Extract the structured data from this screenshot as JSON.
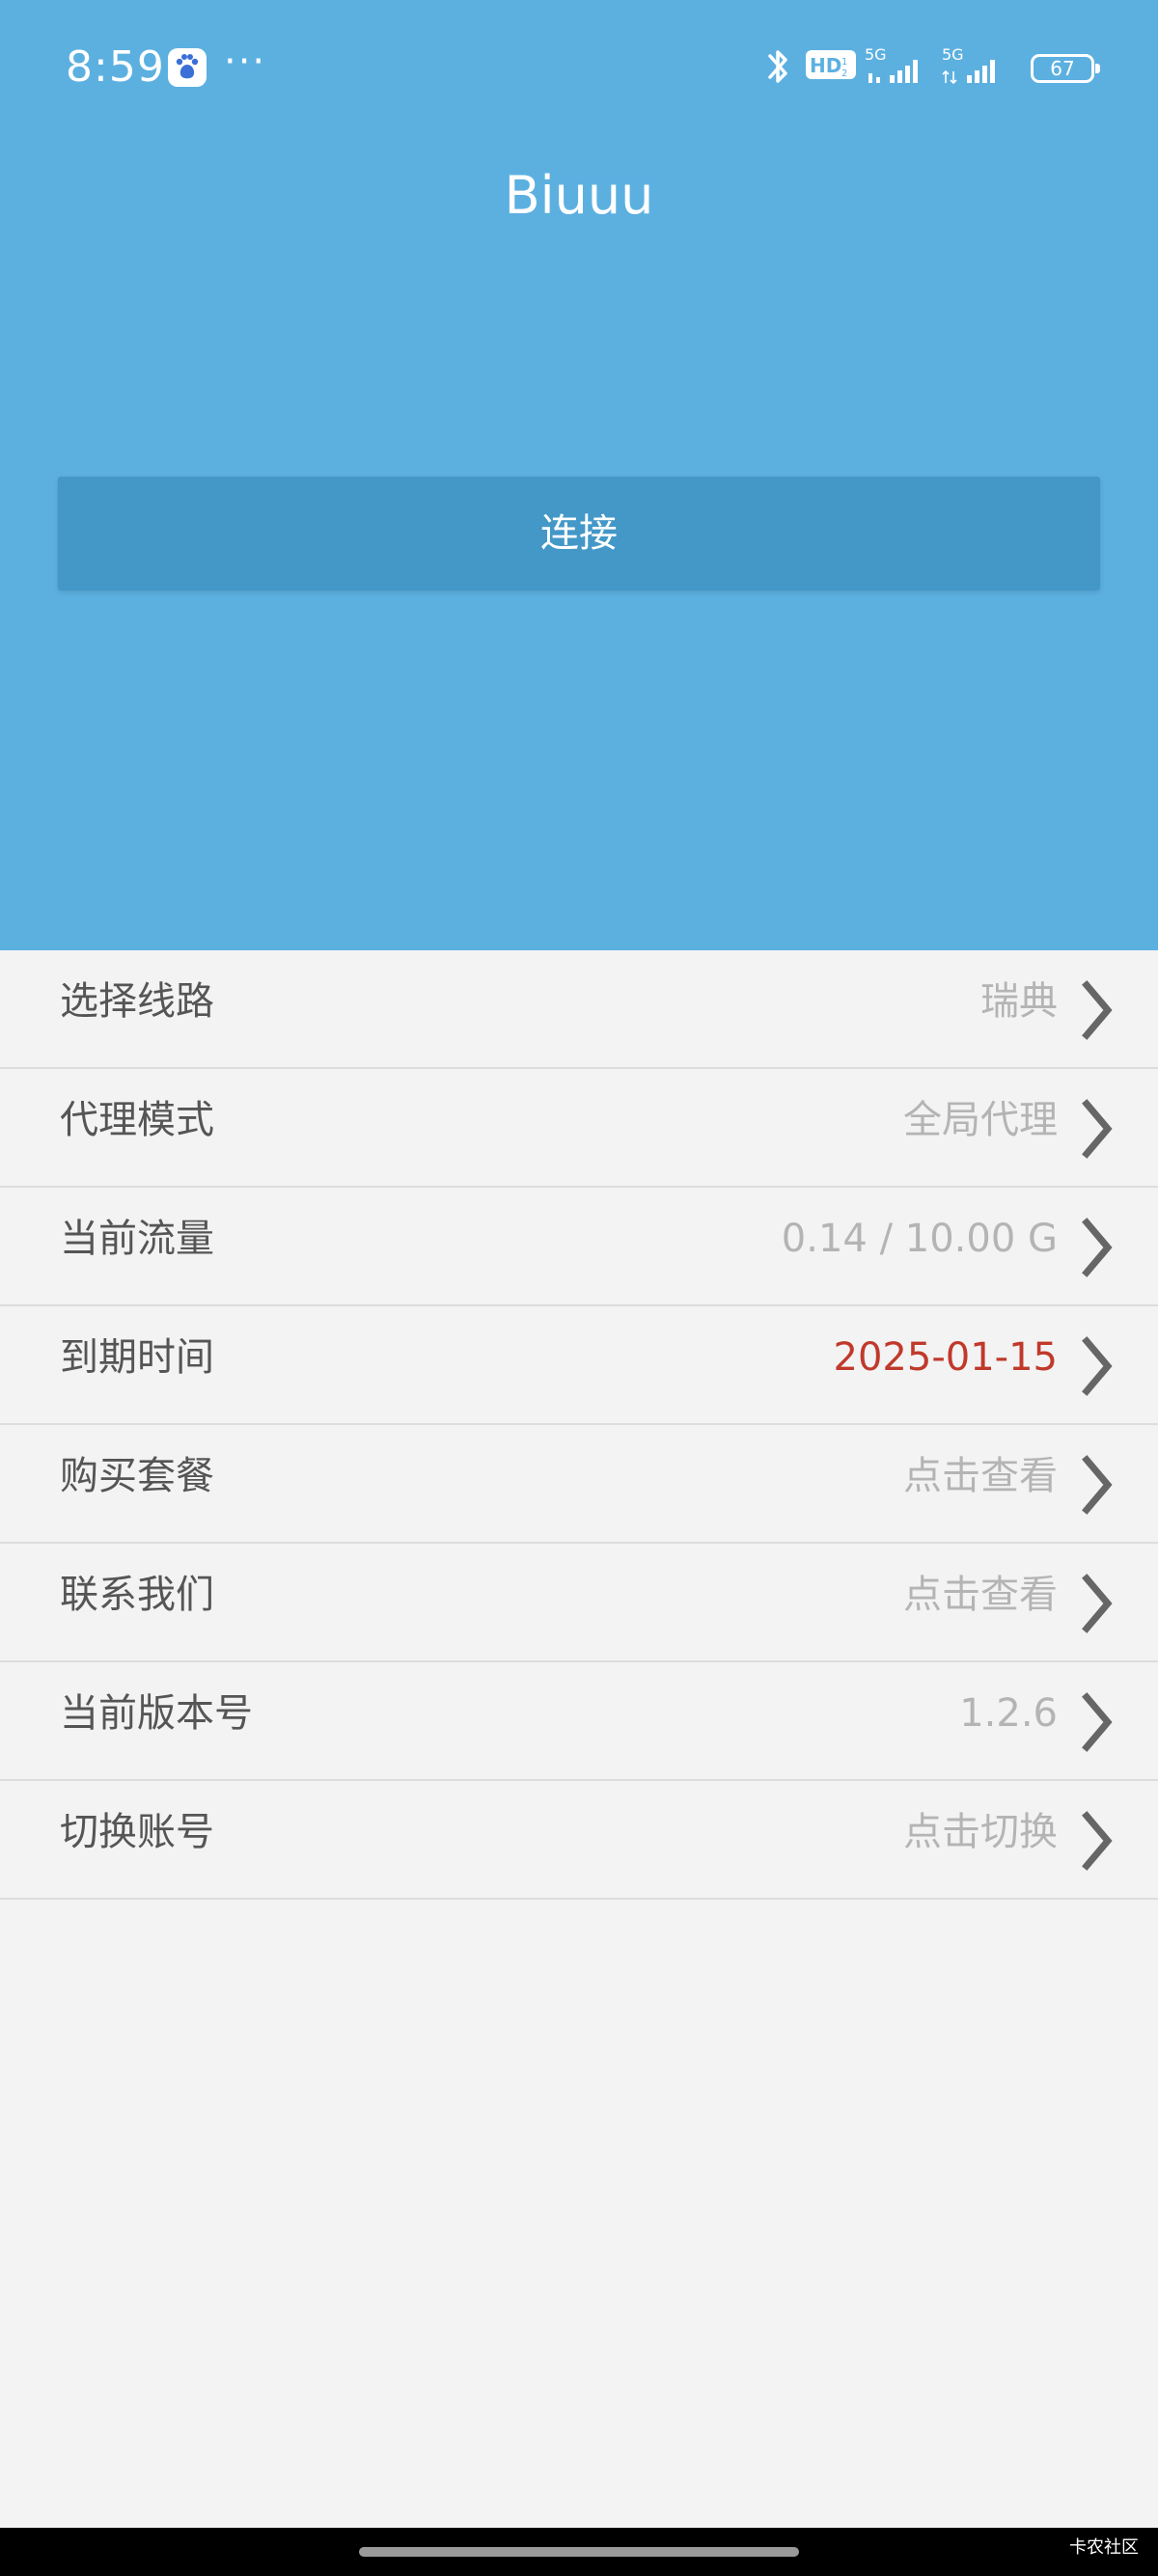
{
  "status_bar": {
    "time": "8:59",
    "more": "···",
    "battery": "67",
    "icons": [
      "baidu-app-icon",
      "bluetooth-icon",
      "hd-voice-icon",
      "signal-5g-icon",
      "signal-5g-icon",
      "battery-icon"
    ]
  },
  "header": {
    "title": "Biuuu"
  },
  "connect": {
    "label": "连接"
  },
  "settings": {
    "items": [
      {
        "label": "选择线路",
        "value": "瑞典"
      },
      {
        "label": "代理模式",
        "value": "全局代理"
      },
      {
        "label": "当前流量",
        "value": "0.14 / 10.00 G"
      },
      {
        "label": "到期时间",
        "value": "2025-01-15"
      },
      {
        "label": "购买套餐",
        "value": "点击查看"
      },
      {
        "label": "联系我们",
        "value": "点击查看"
      },
      {
        "label": "当前版本号",
        "value": "1.2.6"
      },
      {
        "label": "切换账号",
        "value": "点击切换"
      }
    ]
  },
  "watermark": "卡农社区",
  "colors": {
    "hero": "#5cb0e0",
    "button": "#4398c8",
    "background": "#f3f3f3",
    "expiry": "#c0392b",
    "value": "#b4b4b4",
    "label": "#555555"
  }
}
